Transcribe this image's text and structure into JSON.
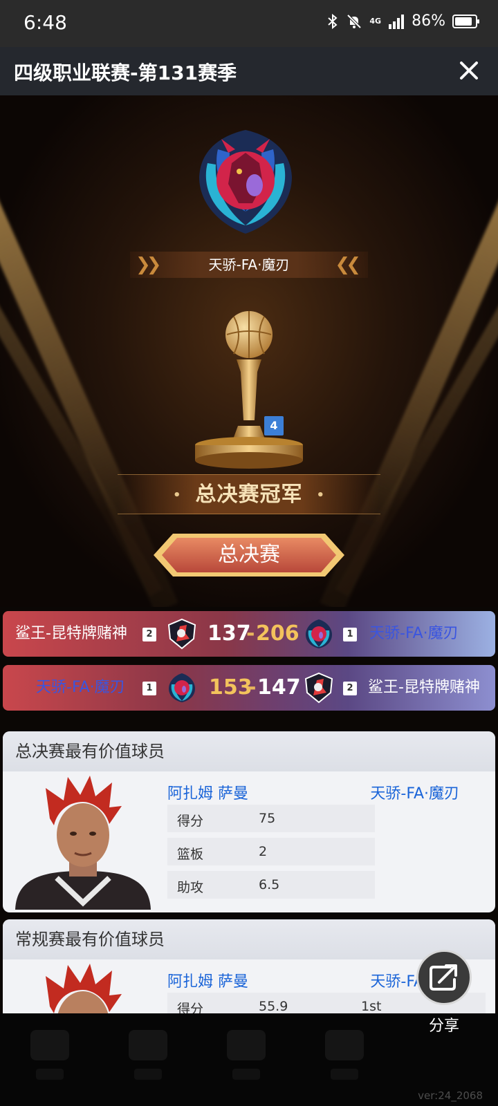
{
  "status_bar": {
    "time": "6:48",
    "network": "4G",
    "battery": "86%",
    "battery_level": 0.86
  },
  "header": {
    "title": "四级职业联赛-第131赛季"
  },
  "hero": {
    "team_name": "天骄-FA·魔刃",
    "trophy_count": "4",
    "champion_label": "总决赛冠军",
    "stage_button": "总决赛"
  },
  "games": [
    {
      "left_team": "鲨王-昆特牌赌神",
      "left_seed": "2",
      "left_score": "137",
      "right_score": "206",
      "right_seed": "1",
      "right_team": "天骄-FA·魔刃"
    },
    {
      "left_team": "天骄-FA·魔刃",
      "left_seed": "1",
      "left_score": "153",
      "right_score": "147",
      "right_seed": "2",
      "right_team": "鲨王-昆特牌赌神"
    }
  ],
  "finals_mvp": {
    "heading": "总决赛最有价值球员",
    "player": "阿扎姆 萨曼",
    "team": "天骄-FA·魔刃",
    "stats": [
      {
        "label": "得分",
        "value": "75"
      },
      {
        "label": "篮板",
        "value": "2"
      },
      {
        "label": "助攻",
        "value": "6.5"
      }
    ]
  },
  "regular_mvp": {
    "heading": "常规赛最有价值球员",
    "player": "阿扎姆 萨曼",
    "team": "天骄-FA·魔刃",
    "stats": [
      {
        "label": "得分",
        "value": "55.9",
        "rank": "1st"
      }
    ]
  },
  "share": {
    "label": "分享"
  },
  "footer": {
    "version": "ver:24_2068"
  },
  "colors": {
    "accent_blue": "#1a64d8",
    "gold": "#f3c35c",
    "red_row": "#c9474c",
    "blue_row": "#5b4884"
  }
}
